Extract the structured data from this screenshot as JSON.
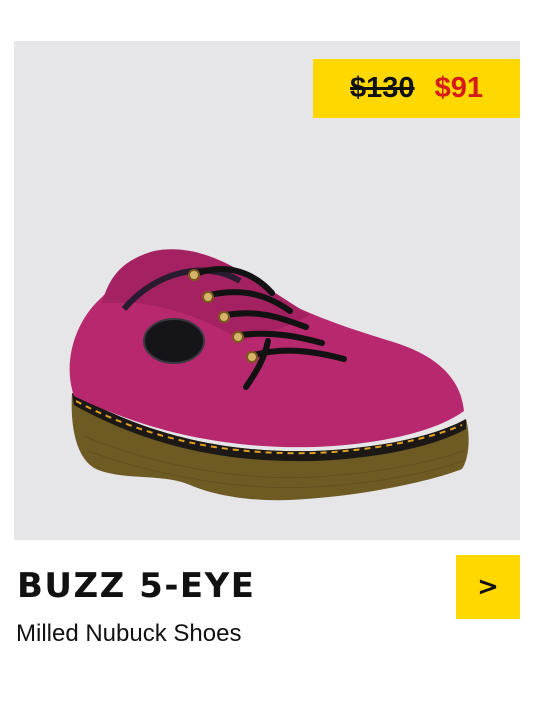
{
  "product": {
    "name": "BUZZ 5-EYE",
    "subtitle": "Milled Nubuck Shoes",
    "original_price": "$130",
    "sale_price": "$91",
    "image_alt": "Pink nubuck platform lace-up shoe with black laces and yellow welt stitching"
  },
  "actions": {
    "next_label": ">"
  },
  "colors": {
    "badge": "#ffd800",
    "sale_price": "#d51a1a",
    "shoe_upper": "#b8286e",
    "sole": "#6b5a22"
  }
}
